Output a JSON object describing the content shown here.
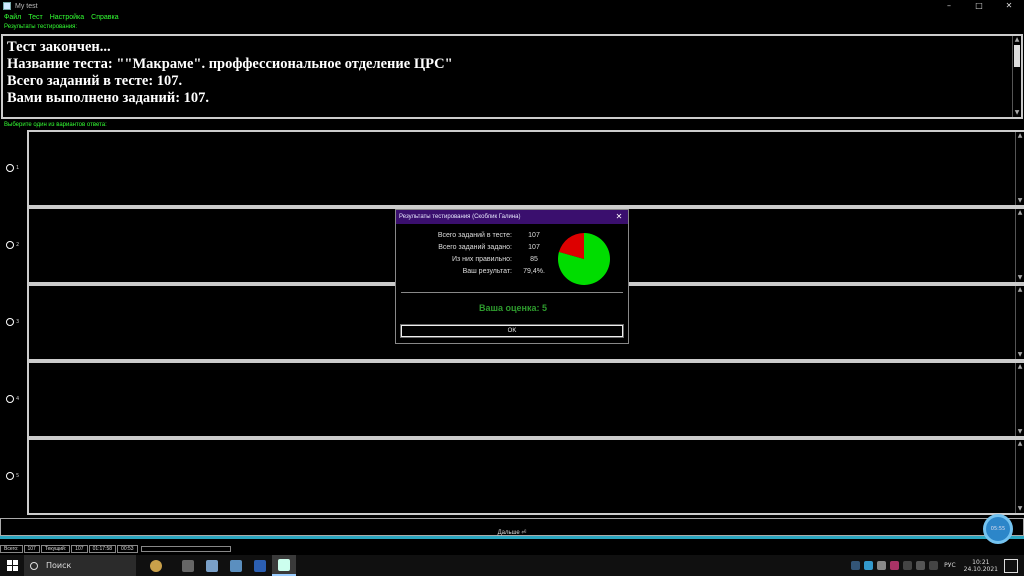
{
  "window": {
    "title": "My test",
    "minimize": "–",
    "maximize": "□",
    "close": "✕"
  },
  "menu": [
    "Файл",
    "Тест",
    "Настройка",
    "Справка"
  ],
  "results_label": "Результаты тестирования:",
  "results_lines": [
    "Тест закончен...",
    "Название теста: \"\"Макраме\". проффессиональное отделение ЦРС\"",
    "Всего заданий в тесте: 107.",
    "Вами выполнено заданий: 107."
  ],
  "options_label": "Выберите один из вариантов ответа:",
  "options": [
    "1",
    "2",
    "3",
    "4",
    "5"
  ],
  "next_button": "Дальше ⏎",
  "timer_bubble": "05:55",
  "status": {
    "total_label": "Всего:",
    "total_value": "107",
    "current_label": "Текущий:",
    "current_value": "107",
    "elapsed": "01:17:58",
    "remaining": "00:53"
  },
  "dialog": {
    "title": "Результаты тестирования (Скоблик Галина)",
    "close": "✕",
    "stats": [
      {
        "label": "Всего заданий в тесте:",
        "value": "107"
      },
      {
        "label": "Всего заданий задано:",
        "value": "107"
      },
      {
        "label": "Из них правильно:",
        "value": "85"
      },
      {
        "label": "Ваш результат:",
        "value": "79,4%."
      }
    ],
    "grade": "Ваша оценка:  5",
    "ok": "OK",
    "pie": {
      "correct_fraction": 0.794,
      "correct_color": "#00dd00",
      "wrong_color": "#dd0000"
    }
  },
  "taskbar": {
    "search_label": "Поиск",
    "lang": "РУС",
    "time": "10:21",
    "date": "24.10.2021"
  },
  "colors": {
    "accent_green": "#33ff33",
    "dialog_title_bg": "#3a0f6e",
    "cyan_line": "#2aa6c0"
  }
}
